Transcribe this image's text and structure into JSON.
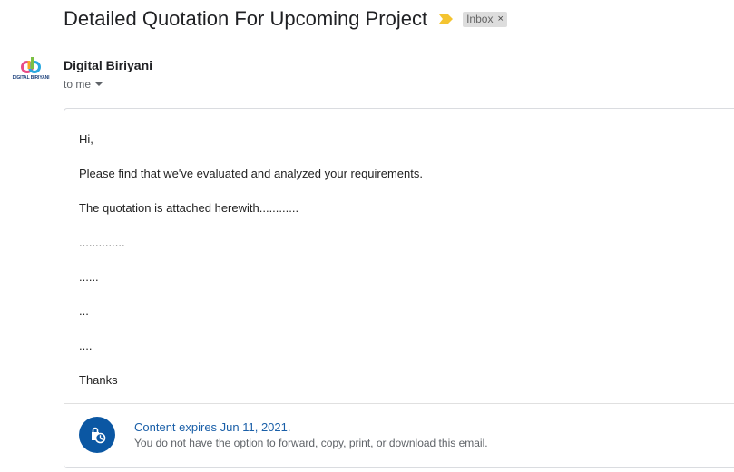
{
  "email": {
    "subject": "Detailed Quotation For Upcoming Project",
    "label": "Inbox",
    "label_close": "×",
    "importance_color": "#f4c430"
  },
  "sender": {
    "name": "Digital Biriyani",
    "recipient": "to me",
    "avatar_text": "DIGITAL BIRIYANI"
  },
  "message": {
    "lines": [
      "Hi,",
      "Please find that we've evaluated and analyzed your requirements.",
      "The quotation is attached herewith............",
      "..............",
      "......",
      "...",
      "....",
      "Thanks"
    ]
  },
  "expiry": {
    "title": "Content expires Jun 11, 2021.",
    "note": "You do not have the option to forward, copy, print, or download this email.",
    "icon": "clock-lock-icon",
    "icon_bg": "#0b57a3"
  }
}
